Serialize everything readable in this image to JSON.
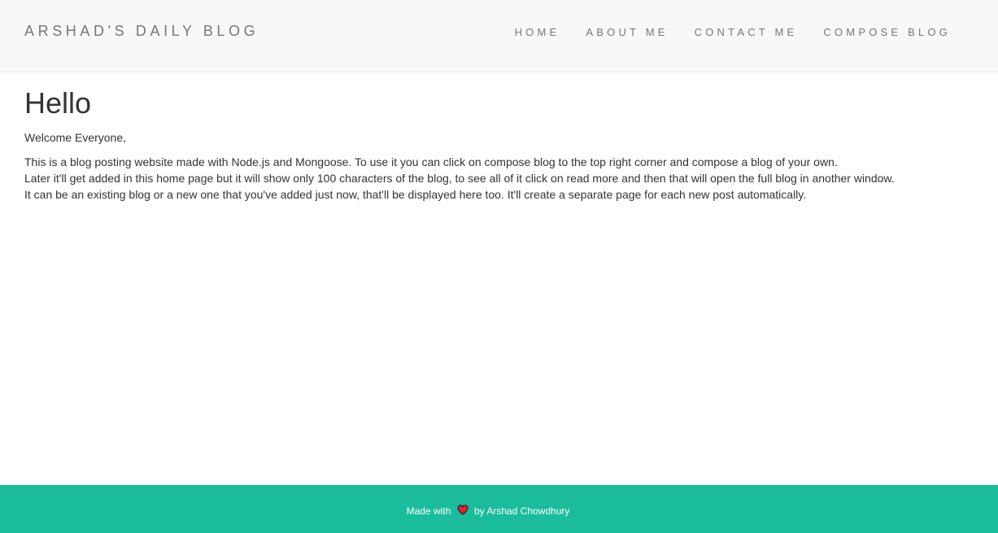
{
  "navbar": {
    "brand": "ARSHAD'S DAILY BLOG",
    "links": [
      {
        "label": "HOME"
      },
      {
        "label": "ABOUT ME"
      },
      {
        "label": "CONTACT ME"
      },
      {
        "label": "COMPOSE BLOG"
      }
    ]
  },
  "main": {
    "title": "Hello",
    "welcome": "Welcome Everyone,",
    "lines": [
      "This is a blog posting website made with Node.js and Mongoose. To use it you can click on compose blog to the top right corner and compose a blog of your own.",
      "Later it'll get added in this home page but it will show only 100 characters of the blog, to see all of it click on read more and then that will open the full blog in another window.",
      "It can be an existing blog or a new one that you've added just now, that'll be displayed here too. It'll create a separate page for each new post automatically."
    ]
  },
  "footer": {
    "made_with": "Made with",
    "heart_icon": "heart-icon",
    "by": "by Arshad Chowdhury"
  },
  "colors": {
    "navbar_bg": "#f8f8f8",
    "footer_bg": "#1abc9c",
    "heart": "#e4202c"
  }
}
